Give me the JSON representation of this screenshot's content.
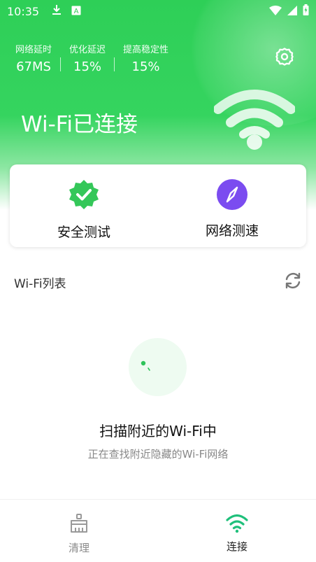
{
  "status_bar": {
    "time": "10:35",
    "icons": [
      "download-icon",
      "a-badge-icon",
      "wifi-icon",
      "signal-icon",
      "battery-icon"
    ]
  },
  "metrics": [
    {
      "label": "网络延时",
      "value": "67MS"
    },
    {
      "label": "优化延迟",
      "value": "15%"
    },
    {
      "label": "提高稳定性",
      "value": "15%"
    }
  ],
  "header": {
    "title": "Wi-Fi已连接"
  },
  "card": {
    "security_label": "安全测试",
    "speed_label": "网络测速"
  },
  "wifi_list": {
    "title": "Wi-Fi列表"
  },
  "scan": {
    "title": "扫描附近的Wi-Fi中",
    "subtitle": "正在查找附近隐藏的Wi-Fi网络"
  },
  "bottom_nav": {
    "clean_label": "清理",
    "connect_label": "连接"
  },
  "colors": {
    "brand_green": "#2ecf57",
    "accent_purple": "#7b4cf0"
  }
}
